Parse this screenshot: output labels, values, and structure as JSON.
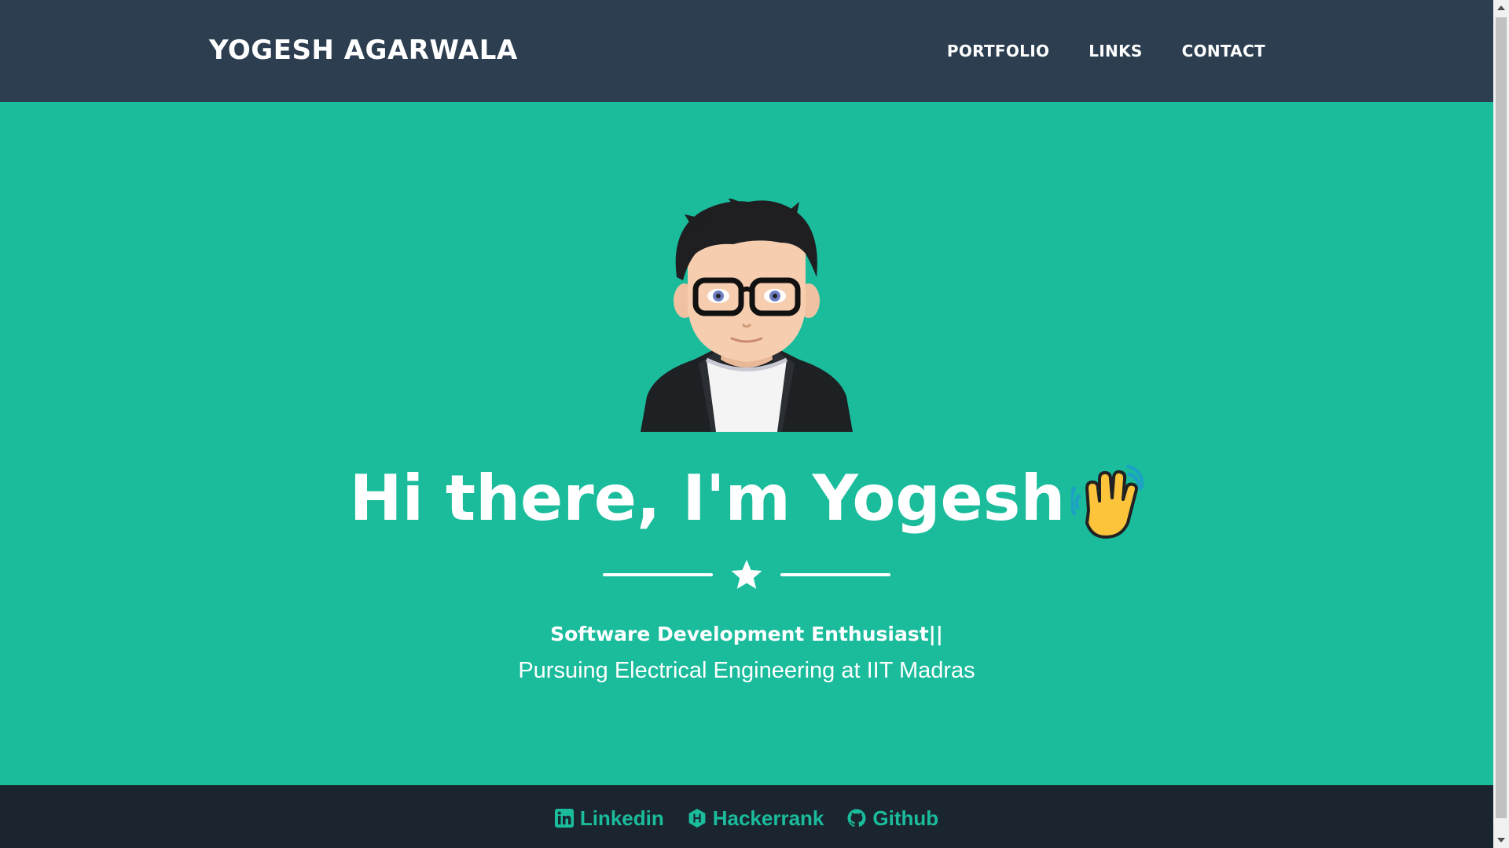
{
  "navbar": {
    "brand": "YOGESH AGARWALA",
    "links": [
      "PORTFOLIO",
      "LINKS",
      "CONTACT"
    ]
  },
  "masthead": {
    "headline": "Hi there, I'm Yogesh",
    "headline_emoji_icon": "waving-hand-icon",
    "divider_icon": "star-icon",
    "subtitle_strong": "Software Development Enthusiast||",
    "subtitle": "Pursuing Electrical Engineering at IIT Madras"
  },
  "footer": {
    "links": [
      {
        "label": "Linkedin",
        "icon": "linkedin-icon"
      },
      {
        "label": "Hackerrank",
        "icon": "hackerrank-icon"
      },
      {
        "label": "Github",
        "icon": "github-icon"
      }
    ]
  },
  "colors": {
    "navbar_bg": "#2c3e50",
    "masthead_bg": "#1abc9c",
    "footer_bg": "#1a252f",
    "accent": "#1abc9c",
    "text": "#ffffff"
  }
}
